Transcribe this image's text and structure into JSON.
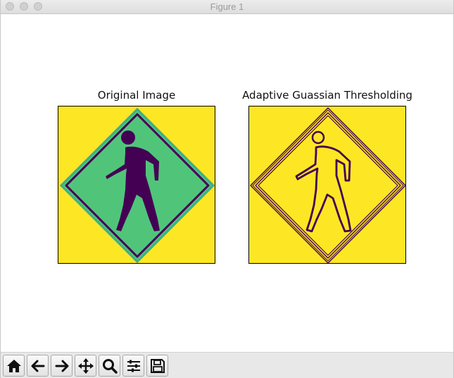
{
  "window": {
    "title": "Figure 1"
  },
  "subplots": [
    {
      "title": "Original Image",
      "colormap": "viridis",
      "colors": {
        "background": "#fde725",
        "sign": "#4ec17c",
        "figure": "#440154"
      }
    },
    {
      "title": "Adaptive Guassian Thresholding",
      "colormap": "viridis",
      "colors": {
        "background": "#fde725",
        "edges": "#440154"
      }
    }
  ],
  "toolbar": {
    "buttons": [
      {
        "name": "home-icon",
        "tooltip": "Home"
      },
      {
        "name": "back-arrow-icon",
        "tooltip": "Back"
      },
      {
        "name": "forward-arrow-icon",
        "tooltip": "Forward"
      },
      {
        "name": "pan-move-icon",
        "tooltip": "Pan"
      },
      {
        "name": "zoom-magnifier-icon",
        "tooltip": "Zoom"
      },
      {
        "name": "subplots-config-icon",
        "tooltip": "Subplots"
      },
      {
        "name": "save-floppy-icon",
        "tooltip": "Save"
      }
    ]
  }
}
